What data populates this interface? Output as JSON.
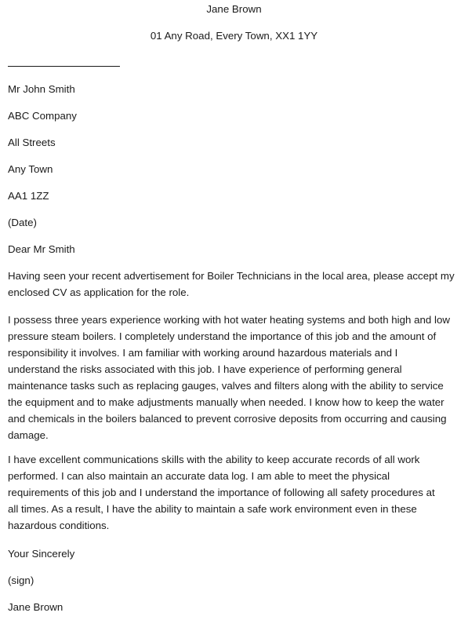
{
  "header": {
    "sender_name": "Jane Brown",
    "sender_address": "01 Any Road, Every Town, XX1 1YY"
  },
  "recipient": {
    "name": "Mr John Smith",
    "company": "ABC Company",
    "street": "All Streets",
    "town": "Any Town",
    "postcode": "AA1 1ZZ",
    "date": "(Date)"
  },
  "salutation": "Dear Mr Smith",
  "paragraphs": [
    {
      "lines": [
        "Having seen your recent advertisement for Boiler Technicians in the local area, please accept my",
        "enclosed CV as application for the role."
      ]
    },
    {
      "lines": [
        "I possess three years experience working with hot water heating systems and both high and low",
        "pressure steam boilers. I completely understand the importance of this job and the amount of",
        "responsibility it involves. I am familiar with working around hazardous materials and I",
        "understand the risks associated with this job. I have experience of performing general",
        "maintenance tasks such as replacing gauges, valves and filters along with the ability to service",
        "the equipment and to make adjustments manually when needed. I know how to keep the water",
        "and chemicals in the boilers balanced to prevent corrosive deposits from occurring and causing",
        "damage."
      ]
    },
    {
      "lines": [
        "I have excellent communications skills with the ability to keep accurate records of all work",
        "performed. I can also maintain an accurate data log. I am able to meet the physical",
        "requirements of this job and I understand the importance of following all safety procedures at",
        "all times. As a result, I have the ability to maintain a safe work environment even in these",
        "hazardous conditions."
      ]
    }
  ],
  "closing": {
    "valediction": "Your Sincerely",
    "signature": "(sign)",
    "name": "Jane Brown"
  }
}
